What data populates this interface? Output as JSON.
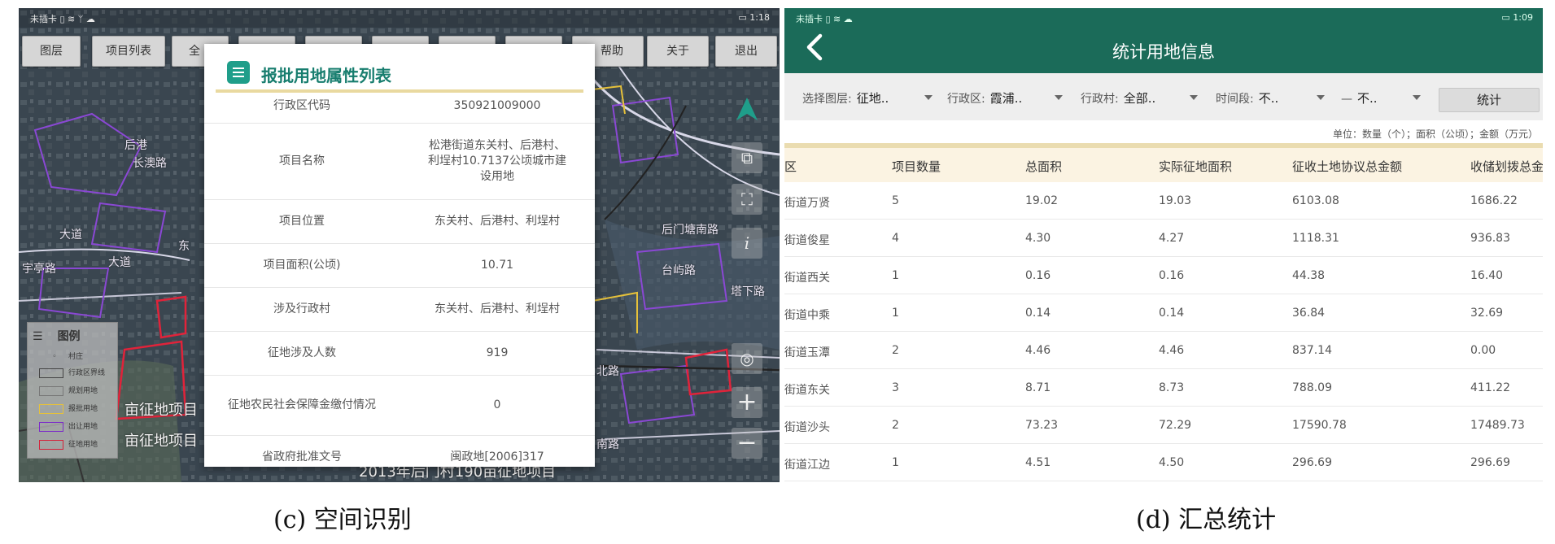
{
  "left_screen": {
    "status_left": "未插卡 ▯ ≋ ᛘ ☁",
    "status_right": "▭ 1:18",
    "toolbar": [
      "图层",
      "项目列表",
      "全",
      "",
      "",
      "",
      "",
      "",
      "帮助",
      "关于",
      "退出"
    ],
    "map_labels": [
      "长澳路",
      "后门塘南路",
      "台屿路",
      "塔下路",
      "北路",
      "南路",
      "大道",
      "宇亭路",
      "后港",
      "2013年后门村190亩征地项目",
      "亩征地项目",
      "亩征地项目",
      "大道",
      "东"
    ],
    "map_controls": [
      "layers-icon",
      "extent-icon",
      "info-icon",
      "locate-icon",
      "zoom-in-icon",
      "zoom-out-icon"
    ],
    "legend": {
      "title": "图例",
      "items": [
        {
          "label": "村庄",
          "color": "#999999"
        },
        {
          "label": "行政区界线",
          "color": "#444444"
        },
        {
          "label": "规划用地",
          "color": "#777777"
        },
        {
          "label": "报批用地",
          "color": "#e6c13a"
        },
        {
          "label": "出让用地",
          "color": "#7b2bc9"
        },
        {
          "label": "征地用地",
          "color": "#d4233a"
        }
      ]
    },
    "dialog": {
      "title": "报批用地属性列表",
      "rows": [
        {
          "key": "行政区代码",
          "value": "350921009000"
        },
        {
          "key": "项目名称",
          "value": "松港街道东关村、后港村、利埕村10.7137公顷城市建设用地"
        },
        {
          "key": "项目位置",
          "value": "东关村、后港村、利埕村"
        },
        {
          "key": "项目面积(公顷)",
          "value": "10.71"
        },
        {
          "key": "涉及行政村",
          "value": "东关村、后港村、利埕村"
        },
        {
          "key": "征地涉及人数",
          "value": "919"
        },
        {
          "key": "征地农民社会保障金缴付情况",
          "value": "0"
        },
        {
          "key": "省政府批准文号",
          "value": "闽政地[2006]317"
        }
      ]
    }
  },
  "right_screen": {
    "status_left": "未插卡 ▯ ≋ ☁",
    "status_right": "▭ 1:09",
    "title": "统计用地信息",
    "filters": {
      "layer_label": "选择图层:",
      "layer_value": "征地..",
      "district_label": "行政区:",
      "district_value": "霞浦..",
      "village_label": "行政村:",
      "village_value": "全部..",
      "period_label": "时间段:",
      "period_from": "不..",
      "period_sep": "—",
      "period_to": "不.."
    },
    "stat_button": "统计",
    "unit_note": "单位：数量（个）；面积（公顷）；金额（万元）",
    "headers": [
      "区",
      "项目数量",
      "总面积",
      "实际征地面积",
      "征收土地协议总金额",
      "收储划拨总金"
    ],
    "rows": [
      [
        "街道万贤",
        "5",
        "19.02",
        "19.03",
        "6103.08",
        "1686.22"
      ],
      [
        "街道俊星",
        "4",
        "4.30",
        "4.27",
        "1118.31",
        "936.83"
      ],
      [
        "街道西关",
        "1",
        "0.16",
        "0.16",
        "44.38",
        "16.40"
      ],
      [
        "街道中乘",
        "1",
        "0.14",
        "0.14",
        "36.84",
        "32.69"
      ],
      [
        "街道玉潭",
        "2",
        "4.46",
        "4.46",
        "837.14",
        "0.00"
      ],
      [
        "街道东关",
        "3",
        "8.71",
        "8.73",
        "788.09",
        "411.22"
      ],
      [
        "街道沙头",
        "2",
        "73.23",
        "72.29",
        "17590.78",
        "17489.73"
      ],
      [
        "街道江边",
        "1",
        "4.51",
        "4.50",
        "296.69",
        "296.69"
      ]
    ]
  },
  "captions": {
    "left": "(c) 空间识别",
    "right": "(d) 汇总统计"
  }
}
